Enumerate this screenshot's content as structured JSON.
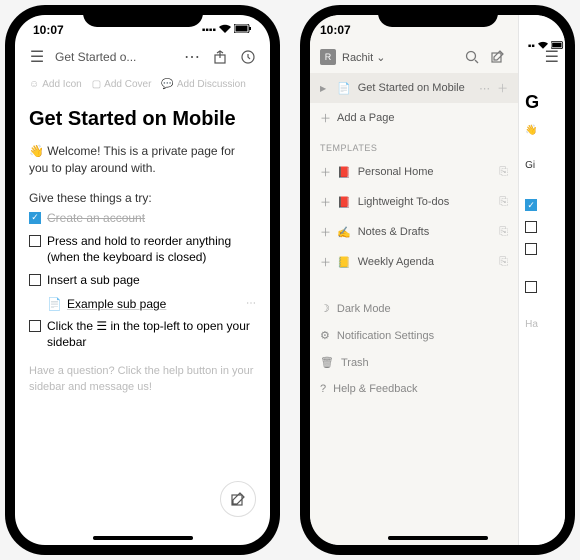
{
  "status": {
    "time": "10:07"
  },
  "phone1": {
    "topbar": {
      "title": "Get Started o..."
    },
    "actions": {
      "add_icon": "Add Icon",
      "add_cover": "Add Cover",
      "add_discussion": "Add Discussion"
    },
    "title": "Get Started on Mobile",
    "welcome": "👋 Welcome! This is a private page for you to play around with.",
    "try_header": "Give these things a try:",
    "todos": {
      "t1": "Create an account",
      "t2": "Press and hold to reorder anything (when the keyboard is closed)",
      "t3": "Insert a sub page",
      "subpage": "Example sub page",
      "t4": "Click the ☰ in the top-left to open your sidebar"
    },
    "footer": "Have a question? Click the help button in your sidebar and message us!"
  },
  "phone2": {
    "user": {
      "initial": "R",
      "name": "Rachit ⌄"
    },
    "pages": {
      "current": "Get Started on Mobile",
      "add": "Add a Page"
    },
    "templates_header": "TEMPLATES",
    "templates": {
      "t1": {
        "emoji": "📕",
        "label": "Personal Home"
      },
      "t2": {
        "emoji": "📕",
        "label": "Lightweight To-dos"
      },
      "t3": {
        "emoji": "✍️",
        "label": "Notes & Drafts"
      },
      "t4": {
        "emoji": "📒",
        "label": "Weekly Agenda"
      }
    },
    "footer": {
      "dark": "Dark Mode",
      "notif": "Notification Settings",
      "trash": "Trash",
      "help": "Help & Feedback"
    },
    "peek": {
      "title_initial": "G",
      "welcome_initial": "👋",
      "give": "Gi"
    }
  }
}
